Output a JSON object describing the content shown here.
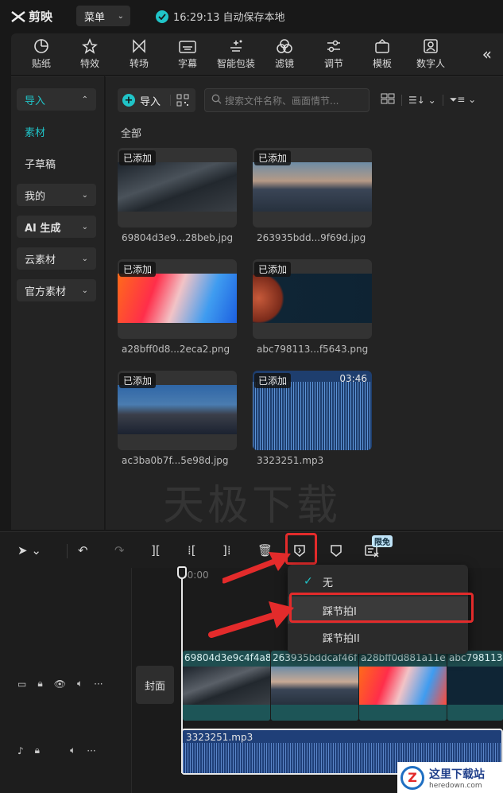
{
  "app": {
    "name": "剪映",
    "menu_label": "菜单",
    "autosave_text": "16:29:13 自动保存本地"
  },
  "toolbar": {
    "tools": [
      {
        "label": "贴纸",
        "icon": "sticker-icon"
      },
      {
        "label": "特效",
        "icon": "effects-icon"
      },
      {
        "label": "转场",
        "icon": "transition-icon"
      },
      {
        "label": "字幕",
        "icon": "caption-icon"
      },
      {
        "label": "智能包装",
        "icon": "smart-package-icon"
      },
      {
        "label": "滤镜",
        "icon": "filter-icon"
      },
      {
        "label": "调节",
        "icon": "adjust-icon"
      },
      {
        "label": "模板",
        "icon": "template-icon"
      },
      {
        "label": "数字人",
        "icon": "digital-human-icon"
      }
    ],
    "collapse_icon": "double-chevron-left-icon"
  },
  "sidebar": {
    "items": [
      {
        "label": "导入"
      },
      {
        "label": "素材"
      },
      {
        "label": "子草稿"
      },
      {
        "label": "我的"
      },
      {
        "label": "AI 生成"
      },
      {
        "label": "云素材"
      },
      {
        "label": "官方素材"
      }
    ]
  },
  "media": {
    "import_label": "导入",
    "search_placeholder": "搜索文件名称、画面情节...",
    "section_label": "全部",
    "added_badge": "已添加",
    "items": [
      {
        "filename": "69804d3e9...28beb.jpg"
      },
      {
        "filename": "263935bdd...9f69d.jpg"
      },
      {
        "filename": "a28bff0d8...2eca2.png"
      },
      {
        "filename": "abc798113...f5643.png"
      },
      {
        "filename": "ac3ba0b7f...5e98d.jpg"
      },
      {
        "filename": "3323251.mp3",
        "duration": "03:46"
      }
    ]
  },
  "watermark": "天极下载",
  "timeline": {
    "free_badge": "限免",
    "ruler_start": "00:00",
    "cover_label": "封面",
    "video_clips": [
      {
        "label": "69804d3e9c4f4a8"
      },
      {
        "label": "263935bddcaf46f"
      },
      {
        "label": "a28bff0d881a11e"
      },
      {
        "label": "abc798113"
      }
    ],
    "audio_clip_label": "3323251.mp3"
  },
  "beat_menu": {
    "items": [
      {
        "label": "无",
        "checked": true
      },
      {
        "label": "踩节拍I",
        "checked": false
      },
      {
        "label": "踩节拍II",
        "checked": false
      }
    ]
  },
  "site_logo": {
    "cn": "这里下载站",
    "en": "heredown.com"
  },
  "colors": {
    "accent": "#20c4c8",
    "highlight_box": "#e32b2b",
    "audio_clip": "#1f3f78"
  }
}
